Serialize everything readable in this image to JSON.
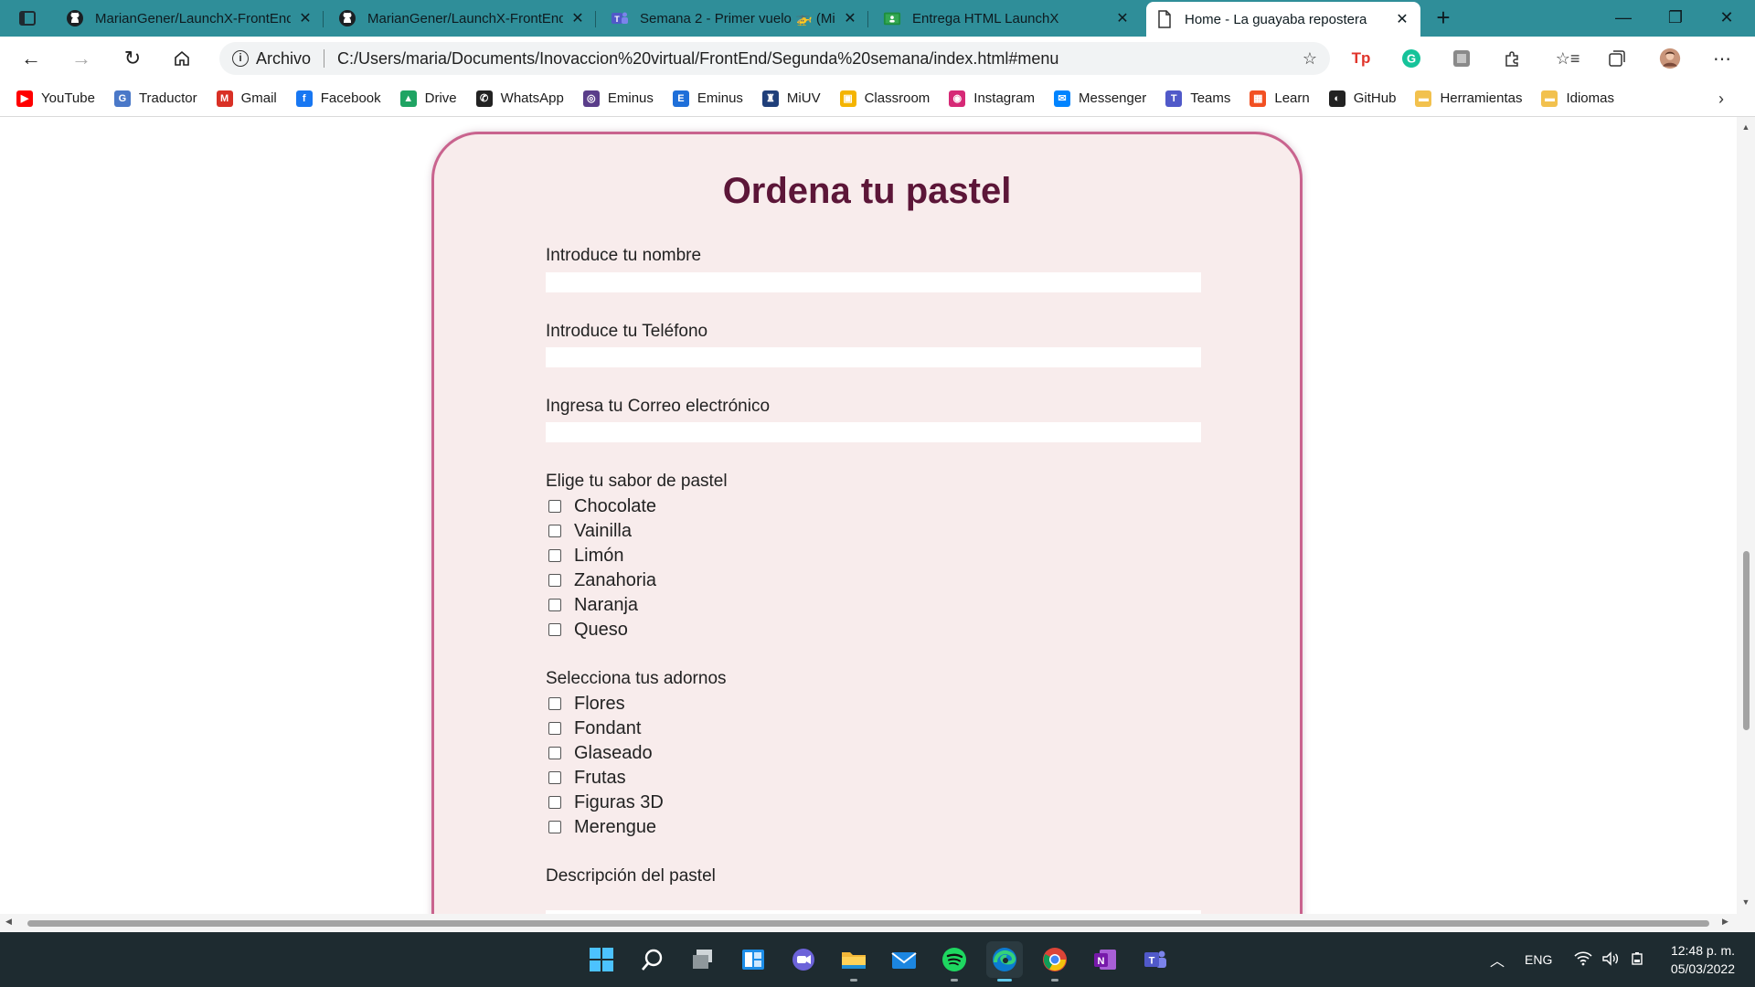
{
  "tabs": [
    {
      "title": "MarianGener/LaunchX-FrontEnd",
      "icon": "github-icon"
    },
    {
      "title": "MarianGener/LaunchX-FrontEnd",
      "icon": "github-icon"
    },
    {
      "title": "Semana 2 - Primer vuelo 🚁 (Mi",
      "icon": "teams-icon"
    },
    {
      "title": "Entrega HTML LaunchX",
      "icon": "classroom-icon"
    },
    {
      "title": "Home - La guayaba repostera",
      "icon": "page-icon",
      "active": true
    }
  ],
  "addressbar": {
    "scheme_label": "Archivo",
    "url": "C:/Users/maria/Documents/Inovaccion%20virtual/FrontEnd/Segunda%20semana/index.html#menu"
  },
  "bookmarks": [
    {
      "label": "YouTube",
      "icon": "youtube-icon",
      "color": "#ff0000"
    },
    {
      "label": "Traductor",
      "icon": "translate-icon",
      "color": "#4a78c8"
    },
    {
      "label": "Gmail",
      "icon": "gmail-icon",
      "color": "#d93025"
    },
    {
      "label": "Facebook",
      "icon": "facebook-icon",
      "color": "#1877f2"
    },
    {
      "label": "Drive",
      "icon": "drive-icon",
      "color": "#1fa463"
    },
    {
      "label": "WhatsApp",
      "icon": "whatsapp-icon",
      "color": "#222222"
    },
    {
      "label": "Eminus",
      "icon": "eminus-icon",
      "color": "#5a3d8a"
    },
    {
      "label": "Eminus",
      "icon": "eminus-e-icon",
      "color": "#1e6fd9"
    },
    {
      "label": "MiUV",
      "icon": "miuv-icon",
      "color": "#1f3f7a"
    },
    {
      "label": "Classroom",
      "icon": "classroom-icon",
      "color": "#f4b400"
    },
    {
      "label": "Instagram",
      "icon": "instagram-icon",
      "color": "#d62976"
    },
    {
      "label": "Messenger",
      "icon": "messenger-icon",
      "color": "#0084ff"
    },
    {
      "label": "Teams",
      "icon": "teams-icon",
      "color": "#5059c9"
    },
    {
      "label": "Learn",
      "icon": "microsoft-icon",
      "color": "#f25022"
    },
    {
      "label": "GitHub",
      "icon": "github-icon",
      "color": "#222222"
    },
    {
      "label": "Herramientas",
      "icon": "folder-icon",
      "color": "#f2c14e"
    },
    {
      "label": "Idiomas",
      "icon": "folder-icon",
      "color": "#f2c14e"
    }
  ],
  "form": {
    "title": "Ordena tu pastel",
    "name_label": "Introduce tu nombre",
    "phone_label": "Introduce tu Teléfono",
    "email_label": "Ingresa tu Correo electrónico",
    "flavor_label": "Elige tu sabor de pastel",
    "flavors": [
      "Chocolate",
      "Vainilla",
      "Limón",
      "Zanahoria",
      "Naranja",
      "Queso"
    ],
    "decor_label": "Selecciona tus adornos",
    "decorations": [
      "Flores",
      "Fondant",
      "Glaseado",
      "Frutas",
      "Figuras 3D",
      "Merengue"
    ],
    "description_label": "Descripción del pastel"
  },
  "tray": {
    "language": "ENG",
    "time": "12:48 p. m.",
    "date": "05/03/2022"
  },
  "colors": {
    "tabstrip": "#2f8e99",
    "card_bg": "#f8ecec",
    "card_border": "#c9638e",
    "title": "#5c1638",
    "taskbar": "#1e2b30"
  }
}
